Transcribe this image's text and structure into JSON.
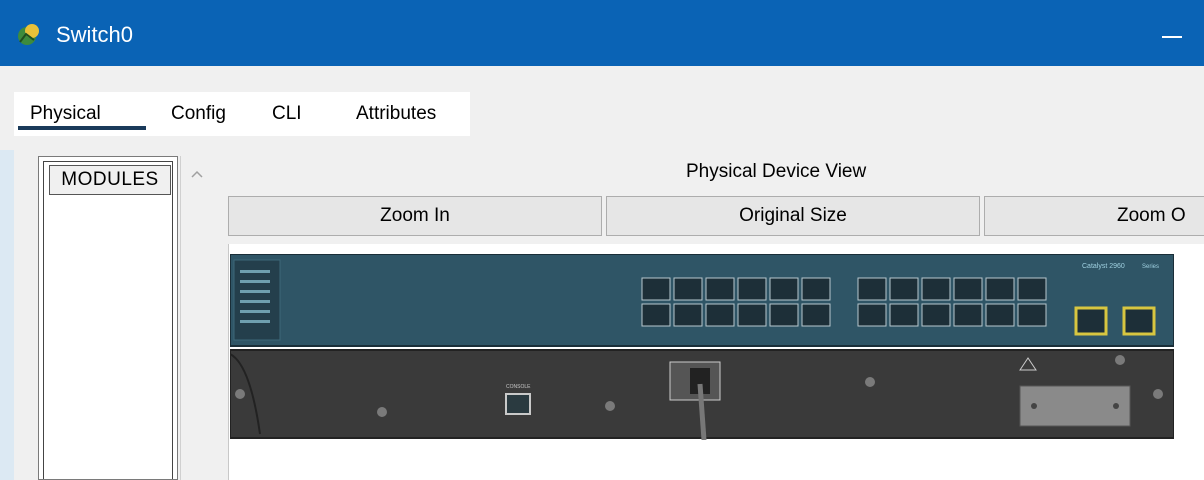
{
  "window": {
    "title": "Switch0",
    "minimize_symbol": "—"
  },
  "tabs": [
    {
      "label": "Physical",
      "active": true
    },
    {
      "label": "Config",
      "active": false
    },
    {
      "label": "CLI",
      "active": false
    },
    {
      "label": "Attributes",
      "active": false
    }
  ],
  "modules": {
    "header": "MODULES",
    "scroll_up_symbol": "^"
  },
  "device_view": {
    "title": "Physical Device View",
    "zoom_in_label": "Zoom In",
    "original_size_label": "Original Size",
    "zoom_out_label": "Zoom O",
    "switch_brand_label": "Catalyst 2960",
    "series_label": "Series",
    "console_label": "CONSOLE"
  },
  "colors": {
    "title_bar": "#0a63b5",
    "tab_underline": "#1a3a5a",
    "switch_body": "#2a4a5a"
  },
  "icons": {
    "app": "packet-tracer-icon"
  }
}
